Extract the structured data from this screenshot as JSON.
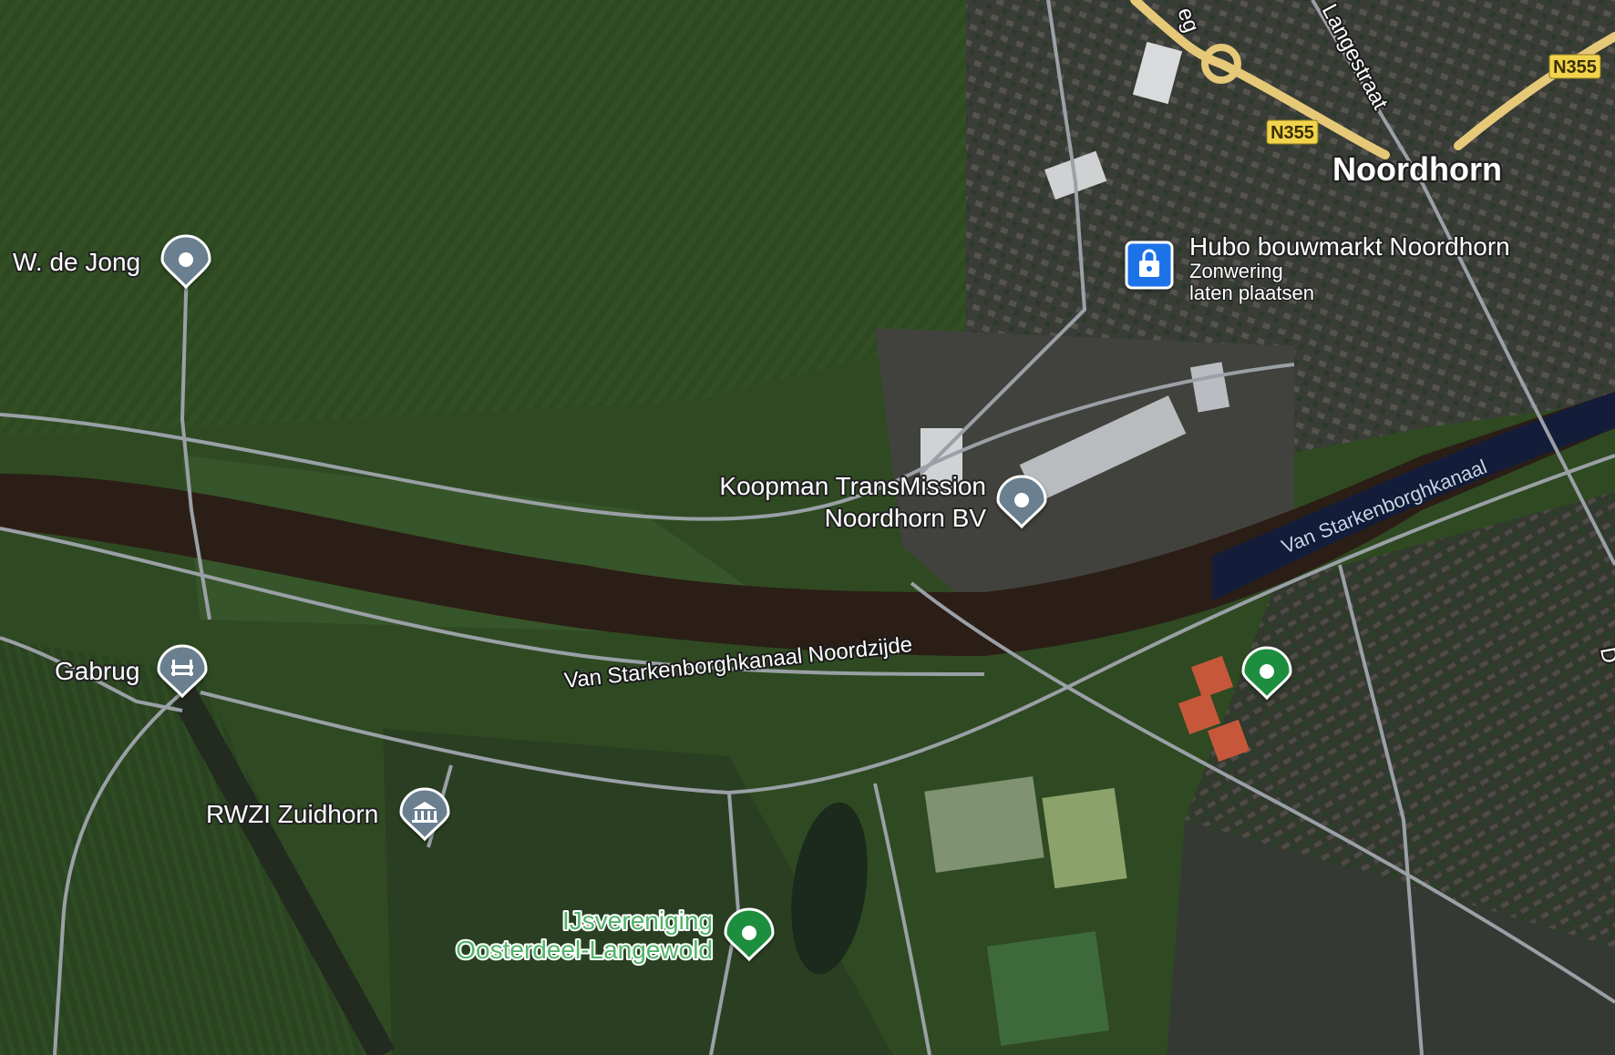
{
  "colors": {
    "field": "#2f4a22",
    "field_light": "#3b5a2b",
    "field_dark": "#243a1a",
    "canal": "#2b1e16",
    "canal_east": "#131d3a",
    "urban": "#3f423c",
    "road": "#9aa0a6",
    "highway": "#e6c978",
    "pin_gray": "#6b7f8f",
    "pin_green": "#1e8e3e",
    "pin_blue": "#1a73e8",
    "shield": "#f2d34c"
  },
  "places": {
    "wdejong": "W. de Jong",
    "gabrug": "Gabrug",
    "rwzi": "RWZI Zuidhorn",
    "koopman_line1": "Koopman TransMission",
    "koopman_line2": "Noordhorn BV",
    "hubo": "Hubo bouwmarkt Noordhorn",
    "hubo_sub1": "Zonwering",
    "hubo_sub2": "laten plaatsen",
    "ijs_line1": "IJsvereniging",
    "ijs_line2": "Oosterdeel-Langewold",
    "noordhorn": "Noordhorn"
  },
  "roads": {
    "canal_road": "Van Starkenborghkanaal Noordzijde",
    "canal_name": "Van Starkenborghkanaal",
    "langestraat": "Langestraat",
    "partial_top": "eg",
    "partial_right": "D",
    "n355_a": "N355",
    "n355_b": "N355"
  },
  "icons": {
    "wdejong": "map-pin-icon",
    "gabrug": "bridge-icon",
    "rwzi": "government-building-icon",
    "koopman": "map-pin-icon",
    "hubo": "shopping-bag-icon",
    "sports_field": "map-pin-icon",
    "ijs": "map-pin-icon"
  }
}
